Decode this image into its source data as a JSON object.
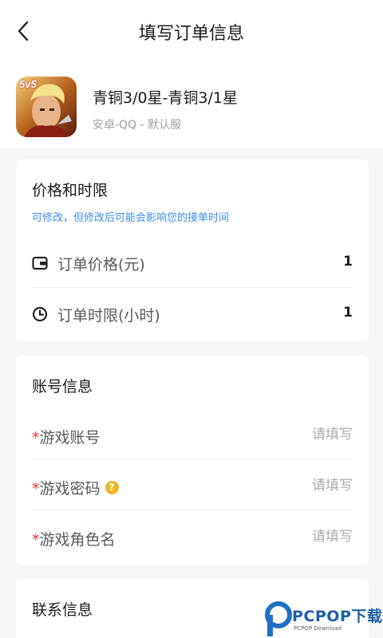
{
  "header": {
    "title": "填写订单信息",
    "back_icon": "chevron-left-icon"
  },
  "game": {
    "title": "青铜3/0星-青铜3/1星",
    "subtitle": "安卓-QQ - 默认服",
    "icon_badge": "5v5"
  },
  "price_section": {
    "title": "价格和时限",
    "hint": "可修改，但修改后可能会影响您的接单时间",
    "rows": [
      {
        "icon": "wallet-icon",
        "label": "订单价格(元)",
        "value": "1"
      },
      {
        "icon": "clock-icon",
        "label": "订单时限(小时)",
        "value": "1"
      }
    ]
  },
  "account_section": {
    "title": "账号信息",
    "required_mark": "*",
    "fields": [
      {
        "label": "游戏账号",
        "placeholder": "请填写",
        "value": ""
      },
      {
        "label": "游戏密码",
        "placeholder": "请填写",
        "value": "",
        "help_icon": "question-icon",
        "help_glyph": "?"
      },
      {
        "label": "游戏角色名",
        "placeholder": "请填写",
        "value": ""
      }
    ]
  },
  "contact_section": {
    "title": "联系信息"
  },
  "watermark": {
    "text": "PCPOP下载",
    "subtext": "PCPOP Download"
  },
  "colors": {
    "accent": "#3d8bef",
    "required": "#e53935",
    "help": "#f0b429",
    "background": "#f5f6f8"
  }
}
